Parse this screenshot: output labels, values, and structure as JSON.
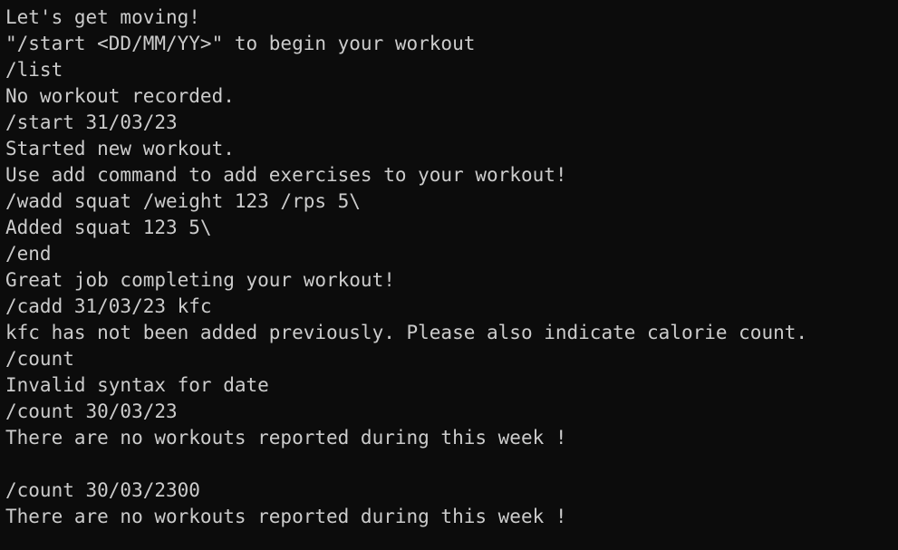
{
  "terminal": {
    "lines": [
      "Let's get moving!",
      "\"/start <DD/MM/YY>\" to begin your workout",
      "/list",
      "No workout recorded.",
      "/start 31/03/23",
      "Started new workout.",
      "Use add command to add exercises to your workout!",
      "/wadd squat /weight 123 /rps 5\\",
      "Added squat 123 5\\",
      "/end",
      "Great job completing your workout!",
      "/cadd 31/03/23 kfc",
      "kfc has not been added previously. Please also indicate calorie count.",
      "/count",
      "Invalid syntax for date",
      "/count 30/03/23",
      "There are no workouts reported during this week !",
      "",
      "/count 30/03/2300",
      "There are no workouts reported during this week !"
    ]
  },
  "colors": {
    "background": "#0c0c0c",
    "foreground": "#cccccc"
  }
}
